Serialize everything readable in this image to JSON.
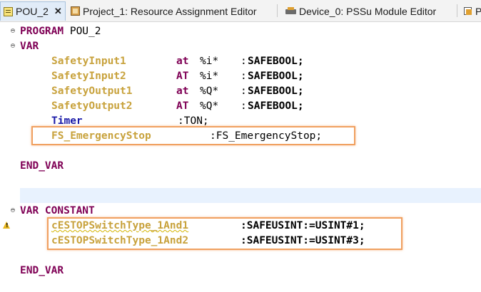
{
  "tabs": [
    {
      "label": "POU_2",
      "icon": "pou-icon",
      "active": true,
      "closable": true
    },
    {
      "label": "Project_1: Resource Assignment Editor",
      "icon": "project-icon"
    },
    {
      "label": "Device_0: PSSu Module Editor",
      "icon": "device-icon"
    },
    {
      "label": "P",
      "icon": "module-icon"
    }
  ],
  "code": {
    "program_kw": "PROGRAM",
    "program_name": "POU_2",
    "var_kw": "VAR",
    "declarations": [
      {
        "name": "SafetyInput1",
        "at": "at",
        "addr": "%i*",
        "colon": ":",
        "type": "SAFEBOOL;"
      },
      {
        "name": "SafetyInput2",
        "at": "AT",
        "addr": "%i*",
        "colon": ":",
        "type": "SAFEBOOL;"
      },
      {
        "name": "SafetyOutput1",
        "at": "at",
        "addr": "%Q*",
        "colon": ":",
        "type": "SAFEBOOL;"
      },
      {
        "name": "SafetyOutput2",
        "at": "AT",
        "addr": "%Q*",
        "colon": ":",
        "type": "SAFEBOOL;"
      }
    ],
    "timer_name": "Timer",
    "timer_type": ":TON;",
    "fb_name": "FS_EmergencyStop",
    "fb_type": ":FS_EmergencyStop;",
    "end_var": "END_VAR",
    "var_constant_kw": "VAR CONSTANT",
    "constants": [
      {
        "name": "cESTOPSwitchType_1And1",
        "type": ":SAFEUSINT:=USINT#1;"
      },
      {
        "name": "cESTOPSwitchType_1And2",
        "type": ":SAFEUSINT:=USINT#3;"
      }
    ],
    "end_var_2": "END_VAR"
  },
  "colors": {
    "keyword": "#7f0055",
    "variable": "#c8a23c",
    "highlight_box": "#f0a060",
    "current_line": "#e8f2fe"
  }
}
